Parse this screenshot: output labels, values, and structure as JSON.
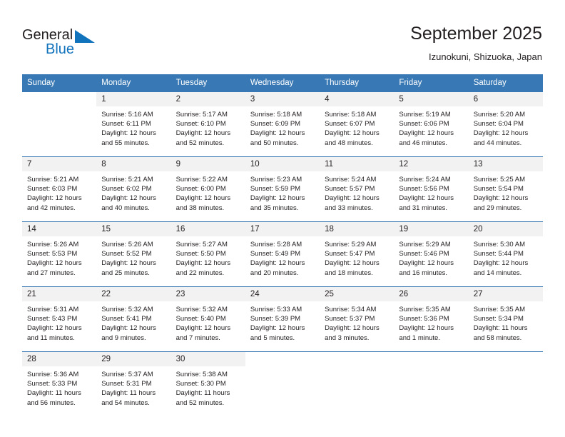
{
  "brand": {
    "name_part1": "General",
    "name_part2": "Blue",
    "triangle_icon": "triangle-icon",
    "accent_color": "#1273bd"
  },
  "header": {
    "title": "September 2025",
    "subtitle": "Izunokuni, Shizuoka, Japan"
  },
  "calendar": {
    "header_bg": "#3878b4",
    "daynum_bg": "#f2f2f2",
    "weekday_headers": [
      "Sunday",
      "Monday",
      "Tuesday",
      "Wednesday",
      "Thursday",
      "Friday",
      "Saturday"
    ],
    "weeks": [
      [
        {
          "day": "",
          "sunrise": "",
          "sunset": "",
          "daylight_line1": "",
          "daylight_line2": "",
          "blank": true
        },
        {
          "day": "1",
          "sunrise": "Sunrise: 5:16 AM",
          "sunset": "Sunset: 6:11 PM",
          "daylight_line1": "Daylight: 12 hours",
          "daylight_line2": "and 55 minutes."
        },
        {
          "day": "2",
          "sunrise": "Sunrise: 5:17 AM",
          "sunset": "Sunset: 6:10 PM",
          "daylight_line1": "Daylight: 12 hours",
          "daylight_line2": "and 52 minutes."
        },
        {
          "day": "3",
          "sunrise": "Sunrise: 5:18 AM",
          "sunset": "Sunset: 6:09 PM",
          "daylight_line1": "Daylight: 12 hours",
          "daylight_line2": "and 50 minutes."
        },
        {
          "day": "4",
          "sunrise": "Sunrise: 5:18 AM",
          "sunset": "Sunset: 6:07 PM",
          "daylight_line1": "Daylight: 12 hours",
          "daylight_line2": "and 48 minutes."
        },
        {
          "day": "5",
          "sunrise": "Sunrise: 5:19 AM",
          "sunset": "Sunset: 6:06 PM",
          "daylight_line1": "Daylight: 12 hours",
          "daylight_line2": "and 46 minutes."
        },
        {
          "day": "6",
          "sunrise": "Sunrise: 5:20 AM",
          "sunset": "Sunset: 6:04 PM",
          "daylight_line1": "Daylight: 12 hours",
          "daylight_line2": "and 44 minutes."
        }
      ],
      [
        {
          "day": "7",
          "sunrise": "Sunrise: 5:21 AM",
          "sunset": "Sunset: 6:03 PM",
          "daylight_line1": "Daylight: 12 hours",
          "daylight_line2": "and 42 minutes."
        },
        {
          "day": "8",
          "sunrise": "Sunrise: 5:21 AM",
          "sunset": "Sunset: 6:02 PM",
          "daylight_line1": "Daylight: 12 hours",
          "daylight_line2": "and 40 minutes."
        },
        {
          "day": "9",
          "sunrise": "Sunrise: 5:22 AM",
          "sunset": "Sunset: 6:00 PM",
          "daylight_line1": "Daylight: 12 hours",
          "daylight_line2": "and 38 minutes."
        },
        {
          "day": "10",
          "sunrise": "Sunrise: 5:23 AM",
          "sunset": "Sunset: 5:59 PM",
          "daylight_line1": "Daylight: 12 hours",
          "daylight_line2": "and 35 minutes."
        },
        {
          "day": "11",
          "sunrise": "Sunrise: 5:24 AM",
          "sunset": "Sunset: 5:57 PM",
          "daylight_line1": "Daylight: 12 hours",
          "daylight_line2": "and 33 minutes."
        },
        {
          "day": "12",
          "sunrise": "Sunrise: 5:24 AM",
          "sunset": "Sunset: 5:56 PM",
          "daylight_line1": "Daylight: 12 hours",
          "daylight_line2": "and 31 minutes."
        },
        {
          "day": "13",
          "sunrise": "Sunrise: 5:25 AM",
          "sunset": "Sunset: 5:54 PM",
          "daylight_line1": "Daylight: 12 hours",
          "daylight_line2": "and 29 minutes."
        }
      ],
      [
        {
          "day": "14",
          "sunrise": "Sunrise: 5:26 AM",
          "sunset": "Sunset: 5:53 PM",
          "daylight_line1": "Daylight: 12 hours",
          "daylight_line2": "and 27 minutes."
        },
        {
          "day": "15",
          "sunrise": "Sunrise: 5:26 AM",
          "sunset": "Sunset: 5:52 PM",
          "daylight_line1": "Daylight: 12 hours",
          "daylight_line2": "and 25 minutes."
        },
        {
          "day": "16",
          "sunrise": "Sunrise: 5:27 AM",
          "sunset": "Sunset: 5:50 PM",
          "daylight_line1": "Daylight: 12 hours",
          "daylight_line2": "and 22 minutes."
        },
        {
          "day": "17",
          "sunrise": "Sunrise: 5:28 AM",
          "sunset": "Sunset: 5:49 PM",
          "daylight_line1": "Daylight: 12 hours",
          "daylight_line2": "and 20 minutes."
        },
        {
          "day": "18",
          "sunrise": "Sunrise: 5:29 AM",
          "sunset": "Sunset: 5:47 PM",
          "daylight_line1": "Daylight: 12 hours",
          "daylight_line2": "and 18 minutes."
        },
        {
          "day": "19",
          "sunrise": "Sunrise: 5:29 AM",
          "sunset": "Sunset: 5:46 PM",
          "daylight_line1": "Daylight: 12 hours",
          "daylight_line2": "and 16 minutes."
        },
        {
          "day": "20",
          "sunrise": "Sunrise: 5:30 AM",
          "sunset": "Sunset: 5:44 PM",
          "daylight_line1": "Daylight: 12 hours",
          "daylight_line2": "and 14 minutes."
        }
      ],
      [
        {
          "day": "21",
          "sunrise": "Sunrise: 5:31 AM",
          "sunset": "Sunset: 5:43 PM",
          "daylight_line1": "Daylight: 12 hours",
          "daylight_line2": "and 11 minutes."
        },
        {
          "day": "22",
          "sunrise": "Sunrise: 5:32 AM",
          "sunset": "Sunset: 5:41 PM",
          "daylight_line1": "Daylight: 12 hours",
          "daylight_line2": "and 9 minutes."
        },
        {
          "day": "23",
          "sunrise": "Sunrise: 5:32 AM",
          "sunset": "Sunset: 5:40 PM",
          "daylight_line1": "Daylight: 12 hours",
          "daylight_line2": "and 7 minutes."
        },
        {
          "day": "24",
          "sunrise": "Sunrise: 5:33 AM",
          "sunset": "Sunset: 5:39 PM",
          "daylight_line1": "Daylight: 12 hours",
          "daylight_line2": "and 5 minutes."
        },
        {
          "day": "25",
          "sunrise": "Sunrise: 5:34 AM",
          "sunset": "Sunset: 5:37 PM",
          "daylight_line1": "Daylight: 12 hours",
          "daylight_line2": "and 3 minutes."
        },
        {
          "day": "26",
          "sunrise": "Sunrise: 5:35 AM",
          "sunset": "Sunset: 5:36 PM",
          "daylight_line1": "Daylight: 12 hours",
          "daylight_line2": "and 1 minute."
        },
        {
          "day": "27",
          "sunrise": "Sunrise: 5:35 AM",
          "sunset": "Sunset: 5:34 PM",
          "daylight_line1": "Daylight: 11 hours",
          "daylight_line2": "and 58 minutes."
        }
      ],
      [
        {
          "day": "28",
          "sunrise": "Sunrise: 5:36 AM",
          "sunset": "Sunset: 5:33 PM",
          "daylight_line1": "Daylight: 11 hours",
          "daylight_line2": "and 56 minutes."
        },
        {
          "day": "29",
          "sunrise": "Sunrise: 5:37 AM",
          "sunset": "Sunset: 5:31 PM",
          "daylight_line1": "Daylight: 11 hours",
          "daylight_line2": "and 54 minutes."
        },
        {
          "day": "30",
          "sunrise": "Sunrise: 5:38 AM",
          "sunset": "Sunset: 5:30 PM",
          "daylight_line1": "Daylight: 11 hours",
          "daylight_line2": "and 52 minutes."
        },
        {
          "day": "",
          "sunrise": "",
          "sunset": "",
          "daylight_line1": "",
          "daylight_line2": "",
          "blank": true
        },
        {
          "day": "",
          "sunrise": "",
          "sunset": "",
          "daylight_line1": "",
          "daylight_line2": "",
          "blank": true
        },
        {
          "day": "",
          "sunrise": "",
          "sunset": "",
          "daylight_line1": "",
          "daylight_line2": "",
          "blank": true
        },
        {
          "day": "",
          "sunrise": "",
          "sunset": "",
          "daylight_line1": "",
          "daylight_line2": "",
          "blank": true
        }
      ]
    ]
  }
}
